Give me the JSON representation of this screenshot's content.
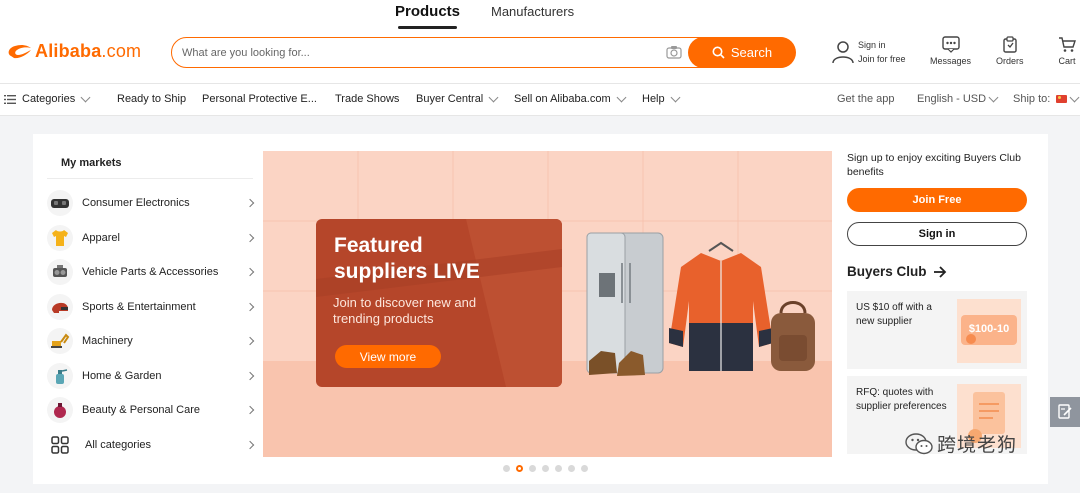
{
  "mode_tabs": [
    {
      "label": "Products",
      "active": true
    },
    {
      "label": "Manufacturers",
      "active": false
    }
  ],
  "logo": {
    "name": "Alibaba",
    "suffix": ".com",
    "brand_color": "#ff6a00"
  },
  "search": {
    "placeholder": "What are you looking for...",
    "value": "",
    "button_label": "Search"
  },
  "header_actions": {
    "signin_label": "Sign in",
    "join_label": "Join for free",
    "messages_label": "Messages",
    "orders_label": "Orders",
    "cart_label": "Cart"
  },
  "nav": {
    "categories": "Categories",
    "items": [
      "Ready to Ship",
      "Personal Protective E...",
      "Trade Shows",
      "Buyer Central",
      "Sell on Alibaba.com",
      "Help"
    ],
    "get_app": "Get the app",
    "language": "English - USD",
    "ship_to": "Ship to:"
  },
  "markets": {
    "title": "My markets",
    "items": [
      {
        "label": "Consumer Electronics",
        "icon": "vr-headset-icon"
      },
      {
        "label": "Apparel",
        "icon": "shirt-icon"
      },
      {
        "label": "Vehicle Parts & Accessories",
        "icon": "engine-icon"
      },
      {
        "label": "Sports & Entertainment",
        "icon": "helmet-icon"
      },
      {
        "label": "Machinery",
        "icon": "excavator-icon"
      },
      {
        "label": "Home & Garden",
        "icon": "spray-bottle-icon"
      },
      {
        "label": "Beauty & Personal Care",
        "icon": "perfume-icon"
      },
      {
        "label": "All categories",
        "icon": "grid-icon"
      }
    ]
  },
  "banner": {
    "title_line1": "Featured",
    "title_line2": "suppliers LIVE",
    "subtitle_line1": "Join to discover new and",
    "subtitle_line2": "trending products",
    "cta": "View more",
    "dots_count": 7,
    "active_dot": 2
  },
  "buyers_club": {
    "intro": "Sign up to enjoy exciting Buyers Club benefits",
    "join_button": "Join Free",
    "signin_button": "Sign in",
    "title": "Buyers Club",
    "cards": [
      {
        "text": "US $10 off with a new supplier",
        "badge": "$100-10"
      },
      {
        "text": "RFQ: quotes with supplier preferences"
      }
    ]
  },
  "watermark": "跨境老狗"
}
